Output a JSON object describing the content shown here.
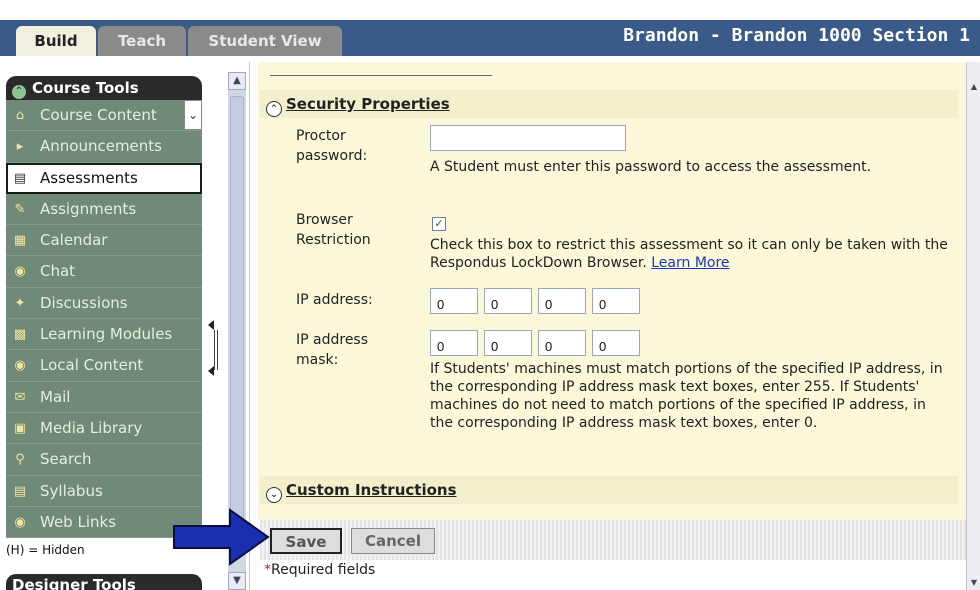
{
  "tabs": {
    "build": "Build",
    "teach": "Teach",
    "student_view": "Student View"
  },
  "course_title": "Brandon - Brandon 1000 Section 1",
  "sidebar": {
    "header": "Course Tools",
    "items": [
      {
        "label": "Course Content",
        "icon": "home-icon"
      },
      {
        "label": "Announcements",
        "icon": "megaphone-icon"
      },
      {
        "label": "Assessments",
        "icon": "assessment-icon"
      },
      {
        "label": "Assignments",
        "icon": "assignment-icon"
      },
      {
        "label": "Calendar",
        "icon": "calendar-icon"
      },
      {
        "label": "Chat",
        "icon": "chat-icon"
      },
      {
        "label": "Discussions",
        "icon": "pin-icon"
      },
      {
        "label": "Learning Modules",
        "icon": "module-icon"
      },
      {
        "label": "Local Content",
        "icon": "globe-icon"
      },
      {
        "label": "Mail",
        "icon": "mail-icon"
      },
      {
        "label": "Media Library",
        "icon": "media-icon"
      },
      {
        "label": "Search",
        "icon": "search-icon"
      },
      {
        "label": "Syllabus",
        "icon": "syllabus-icon"
      },
      {
        "label": "Web Links",
        "icon": "weblink-icon"
      }
    ],
    "hidden_note": "(H) = Hidden",
    "designer_header": "Designer Tools"
  },
  "security": {
    "header": "Security Properties",
    "proctor_label": "Proctor password:",
    "proctor_value": "",
    "proctor_help": "A Student must enter this password to access the assessment.",
    "browser_label": "Browser Restriction",
    "browser_checked": true,
    "browser_help": "Check this box to restrict this assessment so it can only be taken with the Respondus LockDown Browser.",
    "learn_more": "Learn More",
    "ip_label": "IP address:",
    "ip_values": [
      "0",
      "0",
      "0",
      "0"
    ],
    "mask_label": "IP address mask:",
    "mask_values": [
      "0",
      "0",
      "0",
      "0"
    ],
    "mask_help": "If Students' machines must match portions of the specified IP address, in the corresponding IP address mask text boxes, enter 255. If Students' machines do not need to match portions of the specified IP address, in the corresponding IP address mask text boxes, enter 0."
  },
  "custom": {
    "header": "Custom Instructions"
  },
  "buttons": {
    "save": "Save",
    "cancel": "Cancel"
  },
  "required_star": "*",
  "required_text": "Required fields",
  "colors": {
    "topbar": "#3a5a8a",
    "sidebar_item": "#6f8a76",
    "content_bg": "#fbf8d9",
    "section_header": "#f1efcc",
    "arrow": "#1a2fb0"
  }
}
